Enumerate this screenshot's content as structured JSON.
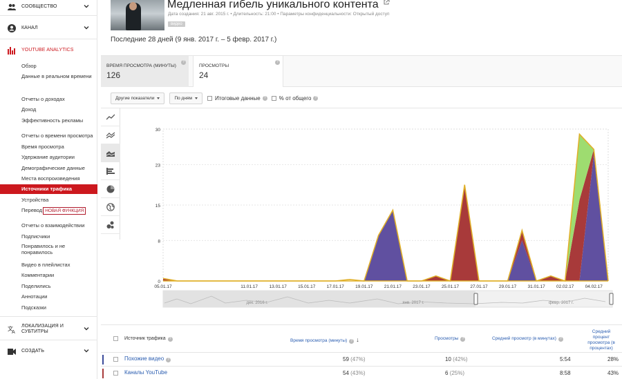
{
  "sidebar": {
    "sections": [
      {
        "label": "Сообщество",
        "icon": "people-icon"
      },
      {
        "label": "Канал",
        "icon": "account-circle-icon"
      },
      {
        "label": "YouTube Analytics",
        "icon": "analytics-bars-icon"
      },
      {
        "label": "Локализация и субтитры",
        "icon": "translate-icon"
      },
      {
        "label": "Создать",
        "icon": "video-camera-icon"
      }
    ],
    "items": [
      "Обзор",
      "Данные в реальном времени",
      "Отчеты о доходах",
      "Доход",
      "Эффективность рекламы",
      "Отчеты о времени просмотра",
      "Время просмотра",
      "Удержание аудитории",
      "Демографические данные",
      "Места воспроизведения",
      "Источники трафика",
      "Устройства",
      "Перевод",
      "Отчеты о взаимодействии",
      "Подписчики",
      "Понравилось и не понравилось",
      "Видео в плейлистах",
      "Комментарии",
      "Поделились",
      "Аннотации",
      "Подсказки"
    ],
    "new_badge": "НОВАЯ ФУНКЦИЯ"
  },
  "video": {
    "title": "Медленная гибель уникального контента",
    "meta": "Дата создания: 21 авг. 2015 г.  •  Длительность: 21:00  •  Параметры конфиденциальности: Открытый доступ",
    "tag": "видео",
    "range": "Последние 28 дней (9 янв. 2017 г. – 5 февр. 2017 г.)"
  },
  "metrics": [
    {
      "label": "Время просмотра (минуты)",
      "value": "126"
    },
    {
      "label": "Просмотры",
      "value": "24"
    }
  ],
  "filters": {
    "metrics_dd": "Другие показатели",
    "period_dd": "По дням",
    "totals": "Итоговые данные",
    "percent": "% от общего"
  },
  "chart_data": {
    "type": "area",
    "x": [
      "05.01.17",
      "06.01.17",
      "07.01.17",
      "08.01.17",
      "09.01.17",
      "10.01.17",
      "11.01.17",
      "12.01.17",
      "13.01.17",
      "14.01.17",
      "15.01.17",
      "16.01.17",
      "17.01.17",
      "18.01.17",
      "19.01.17",
      "20.01.17",
      "21.01.17",
      "22.01.17",
      "23.01.17",
      "24.01.17",
      "25.01.17",
      "26.01.17",
      "27.01.17",
      "28.01.17",
      "29.01.17",
      "30.01.17",
      "31.01.17",
      "01.02.17",
      "02.02.17",
      "03.02.17",
      "04.02.17",
      "05.02.17"
    ],
    "xticks": [
      "05.01.17",
      "11.01.17",
      "13.01.17",
      "15.01.17",
      "17.01.17",
      "19.01.17",
      "21.01.17",
      "23.01.17",
      "25.01.17",
      "27.01.17",
      "29.01.17",
      "31.01.17",
      "02.02.17",
      "04.02.17"
    ],
    "yticks": [
      "0",
      "8",
      "15",
      "23",
      "30"
    ],
    "ylim": [
      0,
      30
    ],
    "series": [
      {
        "color": "#6050a0",
        "values": [
          0,
          0,
          0,
          0,
          0,
          0,
          0,
          0,
          0,
          0,
          0,
          0,
          0,
          0,
          0,
          9,
          14,
          0,
          0,
          0,
          0,
          0,
          0,
          0,
          0,
          8,
          0,
          0,
          0,
          0,
          25,
          0
        ]
      },
      {
        "color": "#a83a3a",
        "values": [
          0.5,
          0,
          0,
          0,
          0,
          0,
          0,
          0,
          0,
          0,
          0,
          0,
          0,
          0,
          0,
          0,
          0,
          0,
          0,
          1,
          0,
          19,
          0,
          0,
          0,
          2,
          0,
          1,
          0,
          16,
          1,
          0
        ]
      },
      {
        "color": "#9edc70",
        "values": [
          0,
          0,
          0,
          0,
          0,
          0,
          0,
          0,
          0,
          0,
          0,
          0,
          0,
          0,
          0,
          0,
          0,
          0,
          0,
          0,
          0,
          0,
          0,
          0,
          0,
          0,
          0,
          0,
          0,
          13,
          0,
          0
        ]
      }
    ],
    "totals": [
      0.5,
      0,
      0,
      0,
      0,
      0,
      0,
      0,
      0,
      0,
      0,
      0,
      0,
      0.3,
      0,
      9,
      14,
      0,
      0,
      1,
      0,
      19,
      0,
      0,
      0,
      10,
      0,
      1,
      0,
      29,
      26,
      0
    ],
    "outline_color": "#e0b02a",
    "nav_labels": [
      "дек. 2016 г.",
      "янв. 2017 г.",
      "февр. 2017 г."
    ]
  },
  "table": {
    "headers": [
      "Источник трафика",
      "Время просмотра (минуты)",
      "Просмотры",
      "Средний просмотр (в минутах)",
      "Средний процент просмотра (в процентах)"
    ],
    "rows": [
      {
        "source": "Похожие видео",
        "watch": "59",
        "watch_pct": "(47%)",
        "views": "10",
        "views_pct": "(42%)",
        "avg": "5:54",
        "pct": "28%",
        "color": "#3a4a9a"
      },
      {
        "source": "Каналы YouTube",
        "watch": "54",
        "watch_pct": "(43%)",
        "views": "6",
        "views_pct": "(25%)",
        "avg": "8:58",
        "pct": "43%",
        "color": "#a83a3a"
      }
    ]
  }
}
